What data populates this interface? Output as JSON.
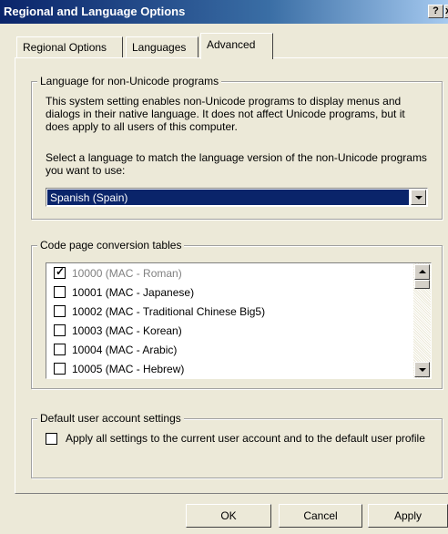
{
  "window": {
    "title": "Regional and Language Options",
    "help_button": "?",
    "close_button": "x"
  },
  "tabs": [
    {
      "label": "Regional Options"
    },
    {
      "label": "Languages"
    },
    {
      "label": "Advanced",
      "active": true
    }
  ],
  "non_unicode": {
    "group_label": "Language for non-Unicode programs",
    "description": "This system setting enables non-Unicode programs to display menus and dialogs in their native language. It does not affect Unicode programs, but it does apply to all users of this computer.",
    "select_prompt": "Select a language to match the language version of the non-Unicode programs you want to use:",
    "selected_language": "Spanish (Spain)"
  },
  "code_pages": {
    "group_label": "Code page conversion tables",
    "items": [
      {
        "label": "10000 (MAC - Roman)",
        "checked": true,
        "disabled": true
      },
      {
        "label": "10001 (MAC - Japanese)",
        "checked": false,
        "disabled": false
      },
      {
        "label": "10002 (MAC - Traditional Chinese Big5)",
        "checked": false,
        "disabled": false
      },
      {
        "label": "10003 (MAC - Korean)",
        "checked": false,
        "disabled": false
      },
      {
        "label": "10004 (MAC - Arabic)",
        "checked": false,
        "disabled": false
      },
      {
        "label": "10005 (MAC - Hebrew)",
        "checked": false,
        "disabled": false
      }
    ]
  },
  "default_user": {
    "group_label": "Default user account settings",
    "checkbox_label": "Apply all settings to the current user account and to the default user profile",
    "checked": false
  },
  "buttons": {
    "ok": "OK",
    "cancel": "Cancel",
    "apply": "Apply"
  },
  "colors": {
    "titlebar_start": "#0a246a",
    "titlebar_end": "#a6caf0",
    "selection": "#0a246a",
    "dialog_bg": "#ece9d8"
  }
}
